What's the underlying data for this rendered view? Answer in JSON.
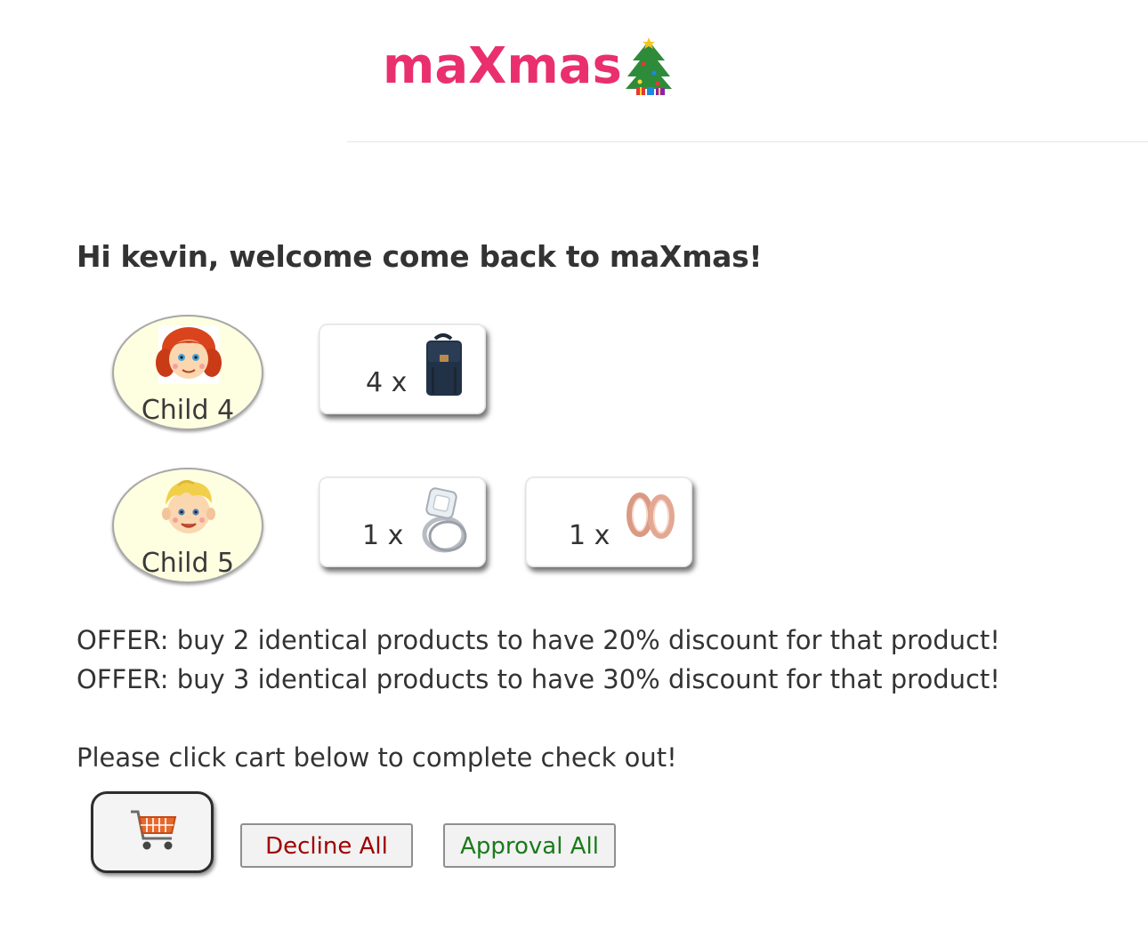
{
  "header": {
    "brand": "maXmas",
    "brand_icon": "christmas-tree-icon",
    "brand_color": "#ea2f6f"
  },
  "welcome": "Hi kevin, welcome come back to maXmas!",
  "children": [
    {
      "name": "Child 4",
      "avatar_icon": "girl-face-icon",
      "gifts": [
        {
          "qty": "4 x",
          "icon": "backpack-icon"
        }
      ]
    },
    {
      "name": "Child 5",
      "avatar_icon": "boy-face-icon",
      "gifts": [
        {
          "qty": "1 x",
          "icon": "diamond-ring-icon"
        },
        {
          "qty": "1 x",
          "icon": "rose-gold-rings-icon"
        }
      ]
    }
  ],
  "offers": [
    "OFFER: buy 2 identical products to have 20% discount for that product!",
    "OFFER: buy 3 identical products to have 30% discount for that product!"
  ],
  "checkout_prompt": "Please click cart below to complete check out!",
  "actions": {
    "cart_icon": "shopping-cart-icon",
    "decline_label": "Decline All",
    "approve_label": "Approval All",
    "decline_color": "#a00000",
    "approve_color": "#1a7a1a"
  }
}
